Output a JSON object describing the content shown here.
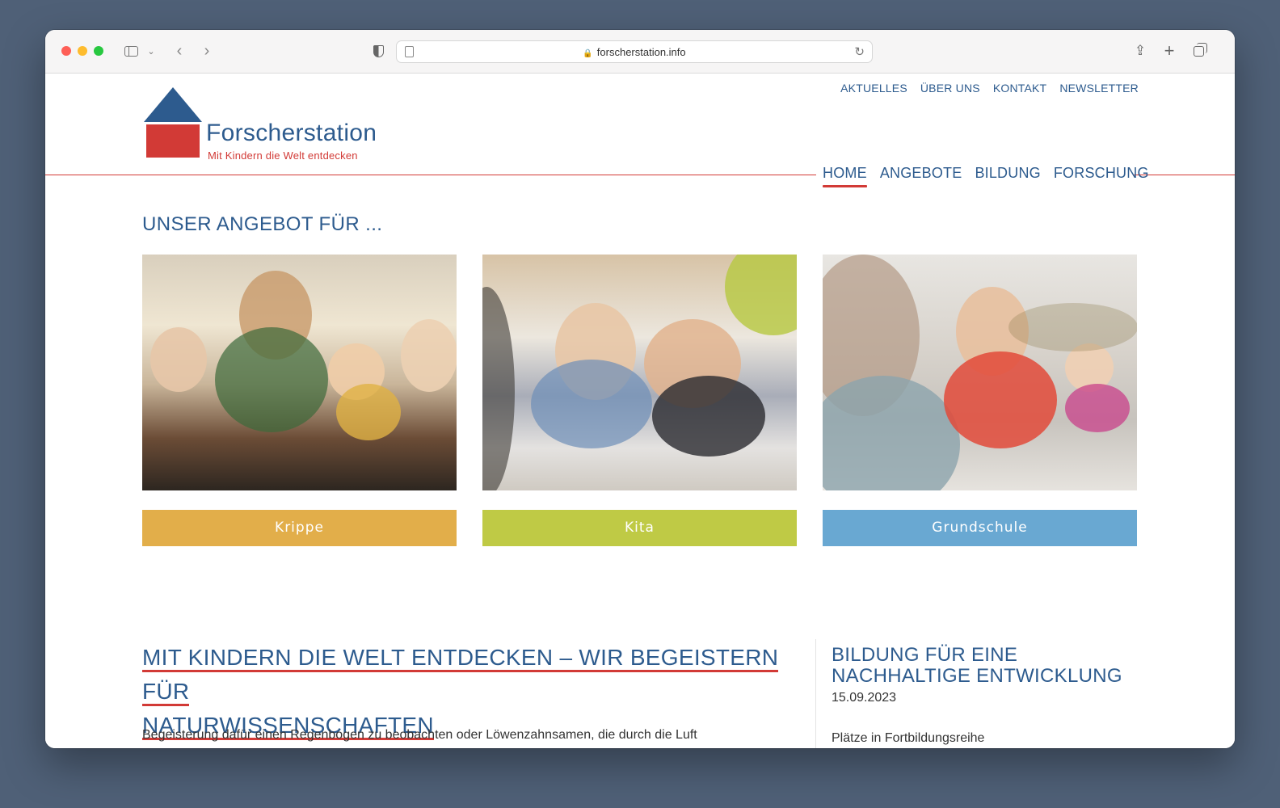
{
  "browser": {
    "url": "forscherstation.info"
  },
  "site": {
    "name": "Forscherstation",
    "tagline": "Mit Kindern die Welt entdecken",
    "top_nav": [
      "AKTUELLES",
      "ÜBER UNS",
      "KONTAKT",
      "NEWSLETTER"
    ],
    "main_nav": [
      {
        "label": "HOME",
        "active": true
      },
      {
        "label": "ANGEBOTE",
        "active": false
      },
      {
        "label": "BILDUNG",
        "active": false
      },
      {
        "label": "FORSCHUNG",
        "active": false
      }
    ]
  },
  "offers": {
    "title": "UNSER ANGEBOT FÜR ...",
    "cards": [
      {
        "label": "Krippe",
        "color": "#e2ae4a"
      },
      {
        "label": "Kita",
        "color": "#bfca45"
      },
      {
        "label": "Grundschule",
        "color": "#69a8d2"
      }
    ]
  },
  "feature": {
    "title_line1": "MIT KINDERN DIE WELT ENTDECKEN – WIR BEGEISTERN FÜR",
    "title_line2": "NATURWISSENSCHAFTEN",
    "text": "Begeisterung dafür einen Regenbogen zu beobachten oder Löwenzahnsamen, die durch die Luft"
  },
  "news": {
    "title": "BILDUNG FÜR EINE NACHHALTIGE ENTWICKLUNG",
    "date": "15.09.2023",
    "text": "Plätze in Fortbildungsreihe"
  },
  "colors": {
    "brand_blue": "#2d5b8e",
    "brand_red": "#d23a36"
  }
}
